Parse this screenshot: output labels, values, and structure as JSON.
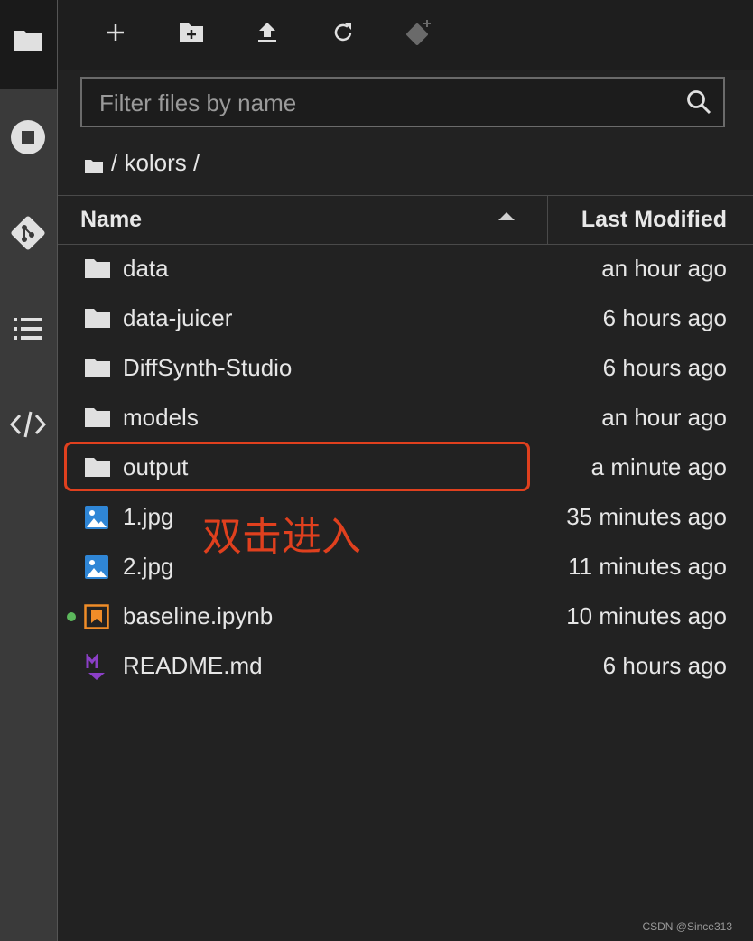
{
  "colors": {
    "accent_annotation": "#e0401e",
    "notebook_dot": "#5cb85c",
    "background": "#222222"
  },
  "activity_bar": {
    "items": [
      {
        "name": "file-browser",
        "icon": "folder-icon"
      },
      {
        "name": "running",
        "icon": "stop-circle-icon"
      },
      {
        "name": "git",
        "icon": "git-icon"
      },
      {
        "name": "toc",
        "icon": "list-icon"
      },
      {
        "name": "code-snippets",
        "icon": "code-icon"
      }
    ]
  },
  "toolbar": {
    "items": [
      {
        "name": "new-launcher",
        "icon": "plus-icon"
      },
      {
        "name": "new-folder",
        "icon": "folder-plus-icon"
      },
      {
        "name": "upload",
        "icon": "upload-icon"
      },
      {
        "name": "refresh",
        "icon": "refresh-icon"
      },
      {
        "name": "git-clone",
        "icon": "git-clone-icon"
      }
    ]
  },
  "search": {
    "placeholder": "Filter files by name",
    "value": ""
  },
  "breadcrumb": {
    "text": "/ kolors /"
  },
  "header": {
    "name_label": "Name",
    "modified_label": "Last Modified",
    "sort": "ascending"
  },
  "files": [
    {
      "name": "data",
      "type": "folder",
      "modified": "an hour ago"
    },
    {
      "name": "data-juicer",
      "type": "folder",
      "modified": "6 hours ago"
    },
    {
      "name": "DiffSynth-Studio",
      "type": "folder",
      "modified": "6 hours ago"
    },
    {
      "name": "models",
      "type": "folder",
      "modified": "an hour ago"
    },
    {
      "name": "output",
      "type": "folder",
      "modified": "a minute ago"
    },
    {
      "name": "1.jpg",
      "type": "image",
      "modified": "35 minutes ago"
    },
    {
      "name": "2.jpg",
      "type": "image",
      "modified": "11 minutes ago"
    },
    {
      "name": "baseline.ipynb",
      "type": "notebook",
      "modified": "10 minutes ago",
      "running": true
    },
    {
      "name": "README.md",
      "type": "markdown",
      "modified": "6 hours ago"
    }
  ],
  "annotation": {
    "text": "双击进入"
  },
  "watermark": {
    "text": "CSDN @Since313"
  }
}
